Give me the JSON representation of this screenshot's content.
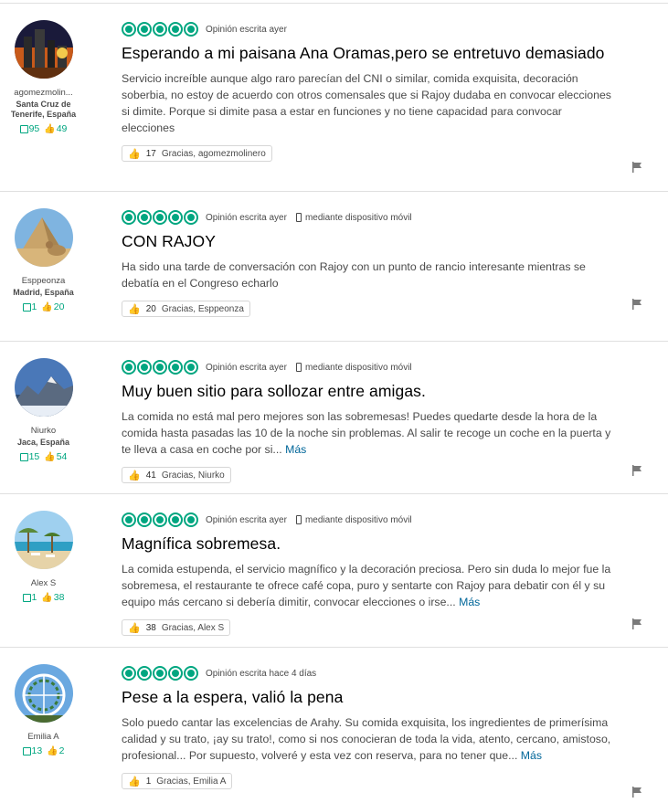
{
  "reviews": [
    {
      "user": {
        "name": "agomezmolin...",
        "location": "Santa Cruz de Tenerife, España",
        "reviews": "95",
        "votes": "49"
      },
      "bubbles": 5,
      "date": "Opinión escrita ayer",
      "mobile": "",
      "title": "Esperando a mi paisana Ana Oramas,pero se entretuvo demasiado",
      "body": "Servicio increíble aunque algo raro parecían del CNI o similar, comida exquisita, decoración soberbia, no estoy de acuerdo con otros comensales que si Rajoy dudaba en convocar elecciones si dimite. Porque si dimite pasa a estar en funciones y no tiene capacidad para convocar elecciones",
      "more": "",
      "thanks_count": "17",
      "thanks_label": "Gracias, agomezmolinero"
    },
    {
      "user": {
        "name": "Esppeonza",
        "location": "Madrid, España",
        "reviews": "1",
        "votes": "20"
      },
      "bubbles": 5,
      "date": "Opinión escrita ayer",
      "mobile": "mediante dispositivo móvil",
      "title": "CON RAJOY",
      "body": "Ha sido una tarde de conversación con Rajoy con un punto de rancio interesante mientras se debatía en el Congreso echarlo",
      "more": "",
      "thanks_count": "20",
      "thanks_label": "Gracias, Esppeonza"
    },
    {
      "user": {
        "name": "Niurko",
        "location": "Jaca, España",
        "reviews": "15",
        "votes": "54"
      },
      "bubbles": 5,
      "date": "Opinión escrita ayer",
      "mobile": "mediante dispositivo móvil",
      "title": "Muy buen sitio para sollozar entre amigas.",
      "body": "La comida no está mal pero mejores son las sobremesas! Puedes quedarte desde la hora de la comida hasta pasadas las 10 de la noche sin problemas. Al salir te recoge un coche en la puerta y te lleva a casa en coche por si... ",
      "more": "Más",
      "thanks_count": "41",
      "thanks_label": "Gracias, Niurko"
    },
    {
      "user": {
        "name": "Alex S",
        "location": "",
        "reviews": "1",
        "votes": "38"
      },
      "bubbles": 5,
      "date": "Opinión escrita ayer",
      "mobile": "mediante dispositivo móvil",
      "title": "Magnífica sobremesa.",
      "body": "La comida estupenda, el servicio magnífico y la decoración preciosa. Pero sin duda lo mejor fue la sobremesa, el restaurante te ofrece café copa, puro y sentarte con Rajoy para debatir con él y su equipo más cercano si debería dimitir, convocar elecciones o irse... ",
      "more": "Más",
      "thanks_count": "38",
      "thanks_label": "Gracias, Alex S"
    },
    {
      "user": {
        "name": "Emilia A",
        "location": "",
        "reviews": "13",
        "votes": "2"
      },
      "bubbles": 5,
      "date": "Opinión escrita hace 4 días",
      "mobile": "",
      "title": "Pese a la espera, valió la pena",
      "body": "Solo puedo cantar las excelencias de Arahy. Su comida exquisita, los ingredientes de primerísima calidad y su trato, ¡ay su trato!, como si nos conocieran de toda la vida, atento, cercano, amistoso, profesional... Por supuesto, volveré y esta vez con reserva, para no tener que... ",
      "more": "Más",
      "thanks_count": "1",
      "thanks_label": "Gracias, Emilia A"
    }
  ],
  "colors": {
    "accent": "#00a680",
    "link": "#006699",
    "text": "#4a4a4a"
  }
}
